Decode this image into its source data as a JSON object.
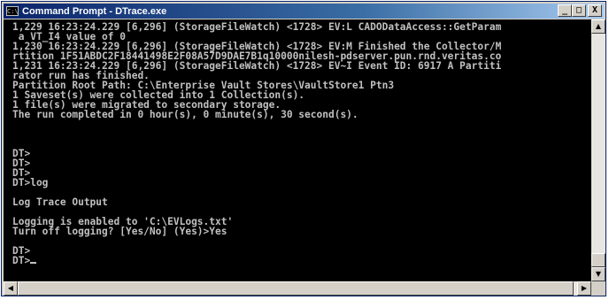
{
  "window": {
    "title": "Command Prompt - DTrace.exe",
    "icon_text": "C:\\",
    "minimize_glyph": "_",
    "restore_glyph": "□",
    "close_glyph": "X"
  },
  "console": {
    "lines": [
      "1,229 16:23:24.229 [6,296] (StorageFileWatch) <1728> EV:L CADODataAccess::GetParam",
      " a VT_I4 value of 0",
      "1,230 16:23:24.229 [6,296] (StorageFileWatch) <1728> EV:M Finished the Collector/M",
      "rtition 1F51ABDC2F18441498E2F08A57D9DAE7B1q10000nilesh-pdserver.pun.rnd.veritas.co",
      "1,231 16:23:24.229 [6,296] (StorageFileWatch) <1728> EV~I Event ID: 6917 A Partiti",
      "rator run has finished.",
      "Partition Root Path: C:\\Enterprise Vault Stores\\VaultStore1 Ptn3",
      "1 Saveset(s) were collected into 1 Collection(s).",
      "1 file(s) were migrated to secondary storage.",
      "The run completed in 0 hour(s), 0 minute(s), 30 second(s).",
      "",
      "",
      "",
      "DT>",
      "DT>",
      "DT>",
      "DT>log",
      "",
      "Log Trace Output",
      "",
      "Logging is enabled to 'C:\\EVLogs.txt'",
      "Turn off logging? [Yes/No] (Yes)>Yes",
      "",
      "DT>",
      "DT>"
    ]
  },
  "scrollbars": {
    "up_arrow": "▲",
    "down_arrow": "▼",
    "left_arrow": "◀",
    "right_arrow": "▶"
  }
}
